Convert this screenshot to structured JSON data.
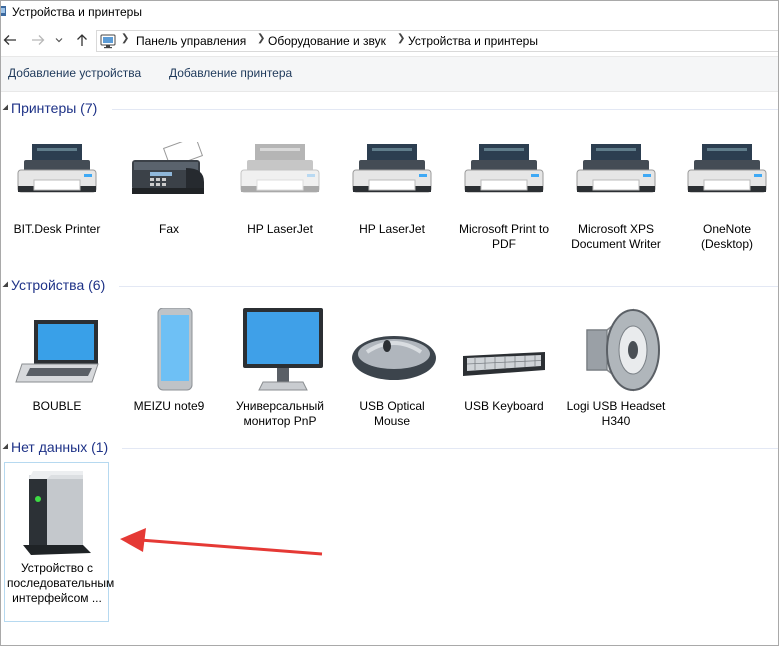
{
  "window": {
    "title": "Устройства и принтеры"
  },
  "breadcrumb": [
    "Панель управления",
    "Оборудование и звук",
    "Устройства и принтеры"
  ],
  "toolbar": {
    "add_device": "Добавление устройства",
    "add_printer": "Добавление принтера"
  },
  "groups": {
    "printers": {
      "title": "Принтеры (7)",
      "items": [
        {
          "label": "BIT.Desk Printer",
          "icon": "printer-icon"
        },
        {
          "label": "Fax",
          "icon": "fax-icon"
        },
        {
          "label": "HP LaserJet",
          "icon": "printer-icon"
        },
        {
          "label": "HP LaserJet",
          "icon": "printer-icon"
        },
        {
          "label": "Microsoft Print to PDF",
          "icon": "printer-icon"
        },
        {
          "label": "Microsoft XPS Document Writer",
          "icon": "printer-icon"
        },
        {
          "label": "OneNote (Desktop)",
          "icon": "printer-icon"
        }
      ]
    },
    "devices": {
      "title": "Устройства (6)",
      "items": [
        {
          "label": "BOUBLE",
          "icon": "laptop-icon"
        },
        {
          "label": "MEIZU note9",
          "icon": "phone-icon"
        },
        {
          "label": "Универсальный монитор PnP",
          "icon": "monitor-icon"
        },
        {
          "label": "USB Optical Mouse",
          "icon": "mouse-icon"
        },
        {
          "label": "USB Keyboard",
          "icon": "keyboard-icon"
        },
        {
          "label": "Logi USB Headset H340",
          "icon": "speaker-icon"
        }
      ]
    },
    "nodata": {
      "title": "Нет данных (1)",
      "items": [
        {
          "label": "Устройство с последовательным интерфейсом ...",
          "icon": "serial-device-icon"
        }
      ]
    }
  },
  "colors": {
    "header_text": "#1e3287",
    "toolbar_text": "#1e395b",
    "arrow": "#e53935",
    "selection_border": "#b6d9f0"
  }
}
